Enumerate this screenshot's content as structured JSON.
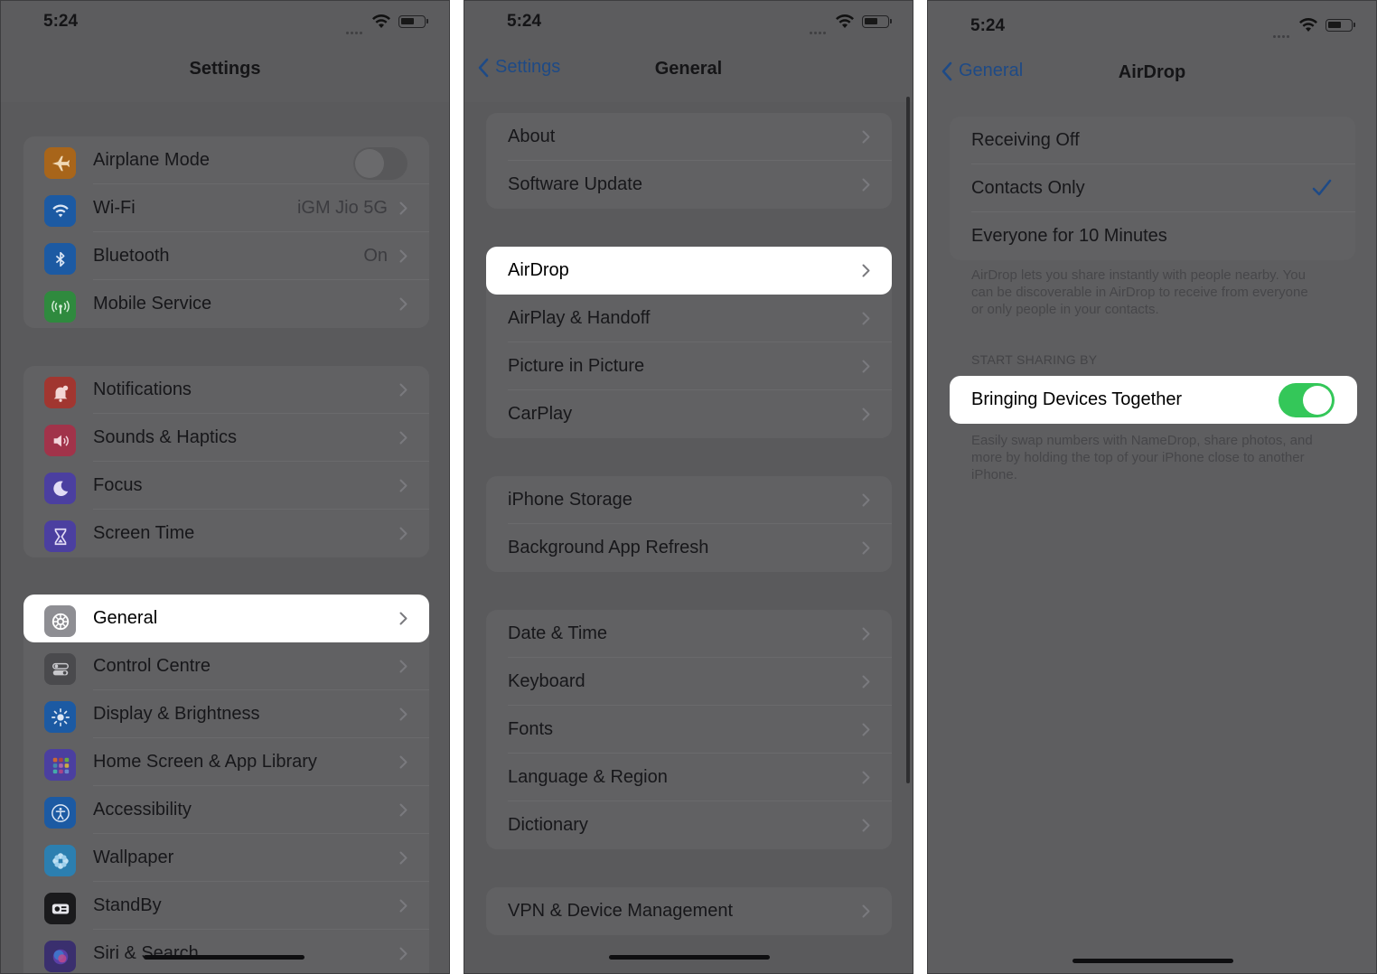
{
  "status": {
    "time": "5:24"
  },
  "settings": {
    "title": "Settings",
    "group1": [
      {
        "label": "Airplane Mode",
        "icon": "airplane-icon",
        "color": "#a8651a",
        "toggle": "off"
      },
      {
        "label": "Wi-Fi",
        "value": "iGM Jio 5G",
        "icon": "wifi-icon",
        "color": "#1c5aa3"
      },
      {
        "label": "Bluetooth",
        "value": "On",
        "icon": "bluetooth-icon",
        "color": "#1c5aa3"
      },
      {
        "label": "Mobile Service",
        "icon": "antenna-icon",
        "color": "#2f8a3e"
      }
    ],
    "group2": [
      {
        "label": "Notifications",
        "icon": "bell-icon",
        "color": "#a13630"
      },
      {
        "label": "Sounds & Haptics",
        "icon": "speaker-icon",
        "color": "#a1334a"
      },
      {
        "label": "Focus",
        "icon": "moon-icon",
        "color": "#4b3fa0"
      },
      {
        "label": "Screen Time",
        "icon": "hourglass-icon",
        "color": "#4b3fa0"
      }
    ],
    "group3": [
      {
        "label": "General",
        "icon": "gear-icon",
        "color": "#8e8e93",
        "highlighted": true
      },
      {
        "label": "Control Centre",
        "icon": "switches-icon",
        "color": "#4a4a4d"
      },
      {
        "label": "Display & Brightness",
        "icon": "sun-icon",
        "color": "#1c5aa3"
      },
      {
        "label": "Home Screen & App Library",
        "icon": "grid-icon",
        "color": "#4b3fa0"
      },
      {
        "label": "Accessibility",
        "icon": "accessibility-icon",
        "color": "#1c5aa3"
      },
      {
        "label": "Wallpaper",
        "icon": "flower-icon",
        "color": "#2c7fb0"
      },
      {
        "label": "StandBy",
        "icon": "standby-icon",
        "color": "#1a1a1c"
      },
      {
        "label": "Siri & Search",
        "icon": "siri-icon",
        "color": "#3a2f6e"
      }
    ]
  },
  "general": {
    "back": "Settings",
    "title": "General",
    "group1": [
      "About",
      "Software Update"
    ],
    "group2": [
      "AirDrop",
      "AirPlay & Handoff",
      "Picture in Picture",
      "CarPlay"
    ],
    "group3": [
      "iPhone Storage",
      "Background App Refresh"
    ],
    "group4": [
      "Date & Time",
      "Keyboard",
      "Fonts",
      "Language & Region",
      "Dictionary"
    ],
    "group5": [
      "VPN & Device Management"
    ]
  },
  "airdrop": {
    "back": "General",
    "title": "AirDrop",
    "options": [
      "Receiving Off",
      "Contacts Only",
      "Everyone for 10 Minutes"
    ],
    "selected_option": "Contacts Only",
    "footer": "AirDrop lets you share instantly with people nearby. You can be discoverable in AirDrop to receive from everyone or only people in your contacts.",
    "section_header": "START SHARING BY",
    "sharing_row": {
      "label": "Bringing Devices Together",
      "toggle": "on"
    },
    "sharing_footer": "Easily swap numbers with NameDrop, share photos, and more by holding the top of your iPhone close to another iPhone.",
    "accent_color": "#34c759",
    "link_color": "#1e4a86"
  }
}
